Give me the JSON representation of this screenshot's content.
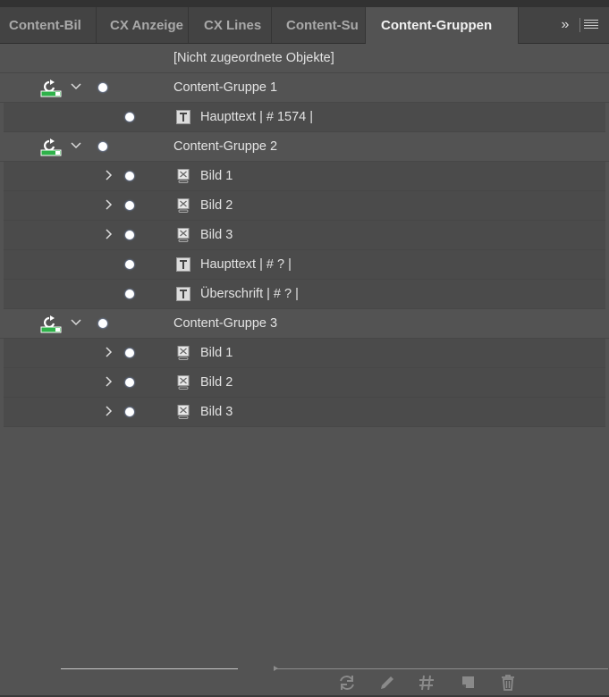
{
  "tabs": [
    {
      "label": "Content-Bil",
      "active": false
    },
    {
      "label": "CX Anzeige",
      "active": false
    },
    {
      "label": "CX Lines",
      "active": false
    },
    {
      "label": "Content-Su",
      "active": false
    },
    {
      "label": "Content-Gruppen",
      "active": true
    }
  ],
  "tab_overflow": "»",
  "list": {
    "unassigned": "[Nicht zugeordnete Objekte]",
    "group1": {
      "label": "Content-Gruppe 1",
      "items": [
        {
          "label": "Haupttext | # 1574 |",
          "type": "text"
        }
      ]
    },
    "group2": {
      "label": "Content-Gruppe 2",
      "items": [
        {
          "label": "Bild 1",
          "type": "image"
        },
        {
          "label": "Bild 2",
          "type": "image"
        },
        {
          "label": "Bild 3",
          "type": "image"
        },
        {
          "label": "Haupttext | # ? |",
          "type": "text"
        },
        {
          "label": "Überschrift | # ? |",
          "type": "text"
        }
      ]
    },
    "group3": {
      "label": "Content-Gruppe 3",
      "items": [
        {
          "label": "Bild 1",
          "type": "image"
        },
        {
          "label": "Bild 2",
          "type": "image"
        },
        {
          "label": "Bild 3",
          "type": "image"
        }
      ]
    }
  },
  "footer_icons": [
    "refresh-icon",
    "pencil-icon",
    "hash-icon",
    "new-page-icon",
    "trash-icon"
  ],
  "colors": {
    "panel": "#535353",
    "tabbar": "#434343",
    "sync_green": "#2fb24a"
  }
}
